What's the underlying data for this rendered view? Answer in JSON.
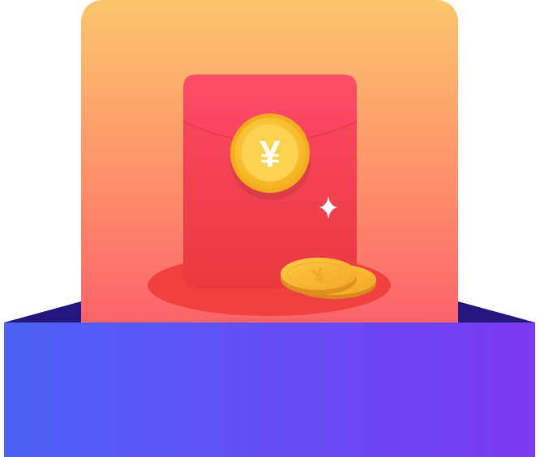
{
  "illustration": {
    "currency_symbol": "¥",
    "colors": {
      "card_top": "#FCC46C",
      "card_bottom": "#FC5E6A",
      "envelope": "#F44A5D",
      "coin_gold": "#FBBF2D",
      "box_left": "#4C60F4",
      "box_right": "#7A3CF2",
      "box_back": "#23167D"
    }
  }
}
